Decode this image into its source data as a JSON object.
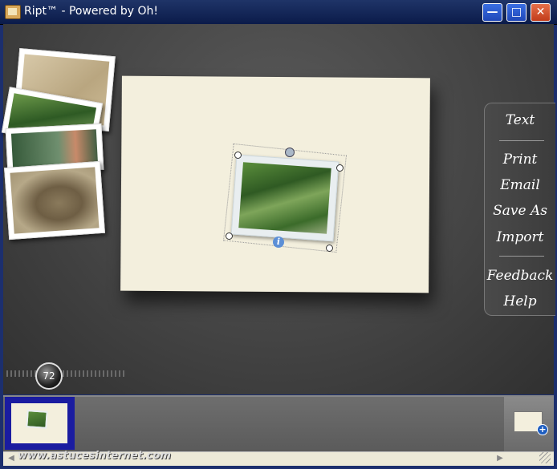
{
  "window": {
    "title": "Ript™ - Powered by Oh!"
  },
  "titlebar_buttons": {
    "minimize": "—",
    "maximize": "□",
    "close": "✕"
  },
  "sidebar_menu": {
    "items": [
      "Text",
      "Print",
      "Email",
      "Save As",
      "Import",
      "Feedback",
      "Help"
    ]
  },
  "zoom": {
    "value": "72"
  },
  "canvas": {
    "info_glyph": "i"
  },
  "add_page": {
    "plus_glyph": "+"
  },
  "scrollbar": {
    "left_arrow": "◀",
    "right_arrow": "▶"
  },
  "watermark": {
    "text": "www.astucesinternet.com"
  },
  "photo_stack": {
    "photos": [
      {
        "subject": "meerkat on sand"
      },
      {
        "subject": "green trees"
      },
      {
        "subject": "jungle with bird"
      },
      {
        "subject": "tortoises"
      }
    ]
  }
}
